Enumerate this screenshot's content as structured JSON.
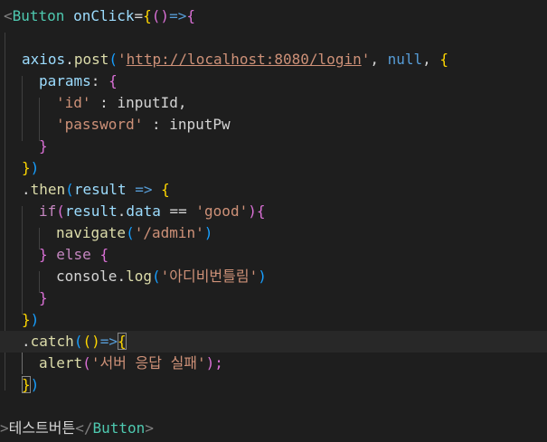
{
  "code": {
    "l1": [
      "<",
      "Button",
      " ",
      "onClick",
      "=",
      "{",
      "()",
      "=>",
      "{"
    ],
    "l3": [
      "axios",
      ".",
      "post",
      "(",
      "'",
      "http://localhost:8080/login",
      "'",
      ", ",
      "null",
      ", ",
      "{"
    ],
    "l4": [
      "params",
      ": ",
      "{"
    ],
    "l5": [
      "'id'",
      " : ",
      "inputId",
      ","
    ],
    "l6": [
      "'password'",
      " : ",
      "inputPw"
    ],
    "l7": [
      "}"
    ],
    "l8": [
      "}",
      ")"
    ],
    "l9": [
      ".",
      "then",
      "(",
      "result",
      " => ",
      "{"
    ],
    "l10": [
      "if",
      "(",
      "result",
      ".",
      "data",
      " == ",
      "'good'",
      ")",
      "{"
    ],
    "l11": [
      "navigate",
      "(",
      "'/admin'",
      ")"
    ],
    "l12": [
      "}",
      " else ",
      "{"
    ],
    "l13": [
      "console",
      ".",
      "log",
      "(",
      "'아디비번틀림'",
      ")"
    ],
    "l14": [
      "}"
    ],
    "l15": [
      "}",
      ")"
    ],
    "l16": [
      ".",
      "catch",
      "(",
      "()",
      "=>",
      "{"
    ],
    "l17": [
      "alert",
      "(",
      "'서버 응답 실패'",
      ");"
    ],
    "l18": [
      "}",
      ")"
    ],
    "l20": [
      ">",
      "테스트버튼",
      "</",
      "Button",
      ">"
    ]
  },
  "colors": {
    "background": "#1e1e1e",
    "tag": "#808080",
    "component": "#4ec9b0",
    "attribute": "#9cdcfe",
    "bracket_gold": "#ffd700",
    "bracket_purple": "#da70d6",
    "bracket_blue": "#179fff",
    "function": "#dcdcaa",
    "string": "#ce9178",
    "keyword": "#c586c0",
    "null": "#569cd6"
  }
}
